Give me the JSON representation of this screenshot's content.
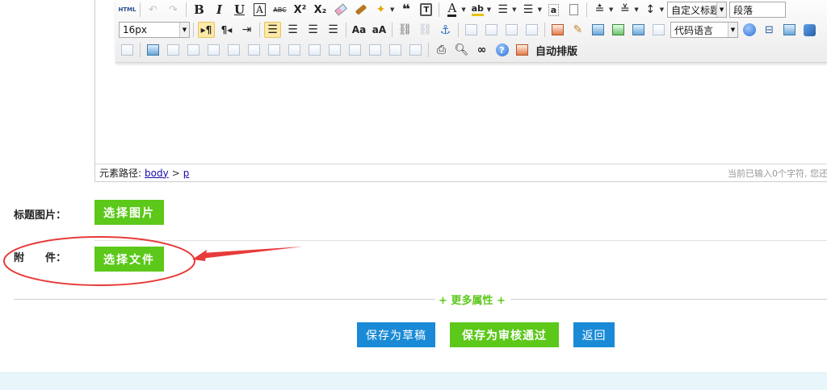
{
  "editor": {
    "toolbar": {
      "html_label": "HTML",
      "bold": "B",
      "italic": "I",
      "underline": "U",
      "border_a": "A",
      "strike": "ABC",
      "superscript": "X²",
      "subscript": "X₂",
      "quote": "❝",
      "font_color": "A",
      "backcolor": "ab",
      "fontsize_value": "16px",
      "custom_title_value": "自定义标题",
      "paragraph_value": "段落",
      "code_language_value": "代码语言",
      "help": "?",
      "auto_typeset_label": "自动排版"
    },
    "status": {
      "path_label": "元素路径:",
      "path_body": "body",
      "path_sep": ">",
      "path_p": "p",
      "char_count": "当前已输入0个字符, 您还"
    }
  },
  "form": {
    "title_image_label": "标题图片：",
    "select_image_button": "选择图片",
    "attachment_label": "附　　件：",
    "select_file_button": "选择文件",
    "more_attributes": "+ 更多属性 +"
  },
  "actions": {
    "save_draft": "保存为草稿",
    "save_approved": "保存为审核通过",
    "back": "返回"
  },
  "colors": {
    "green": "#5cc81a",
    "blue": "#1a8ad6",
    "annotation_red": "#e83a3a"
  }
}
